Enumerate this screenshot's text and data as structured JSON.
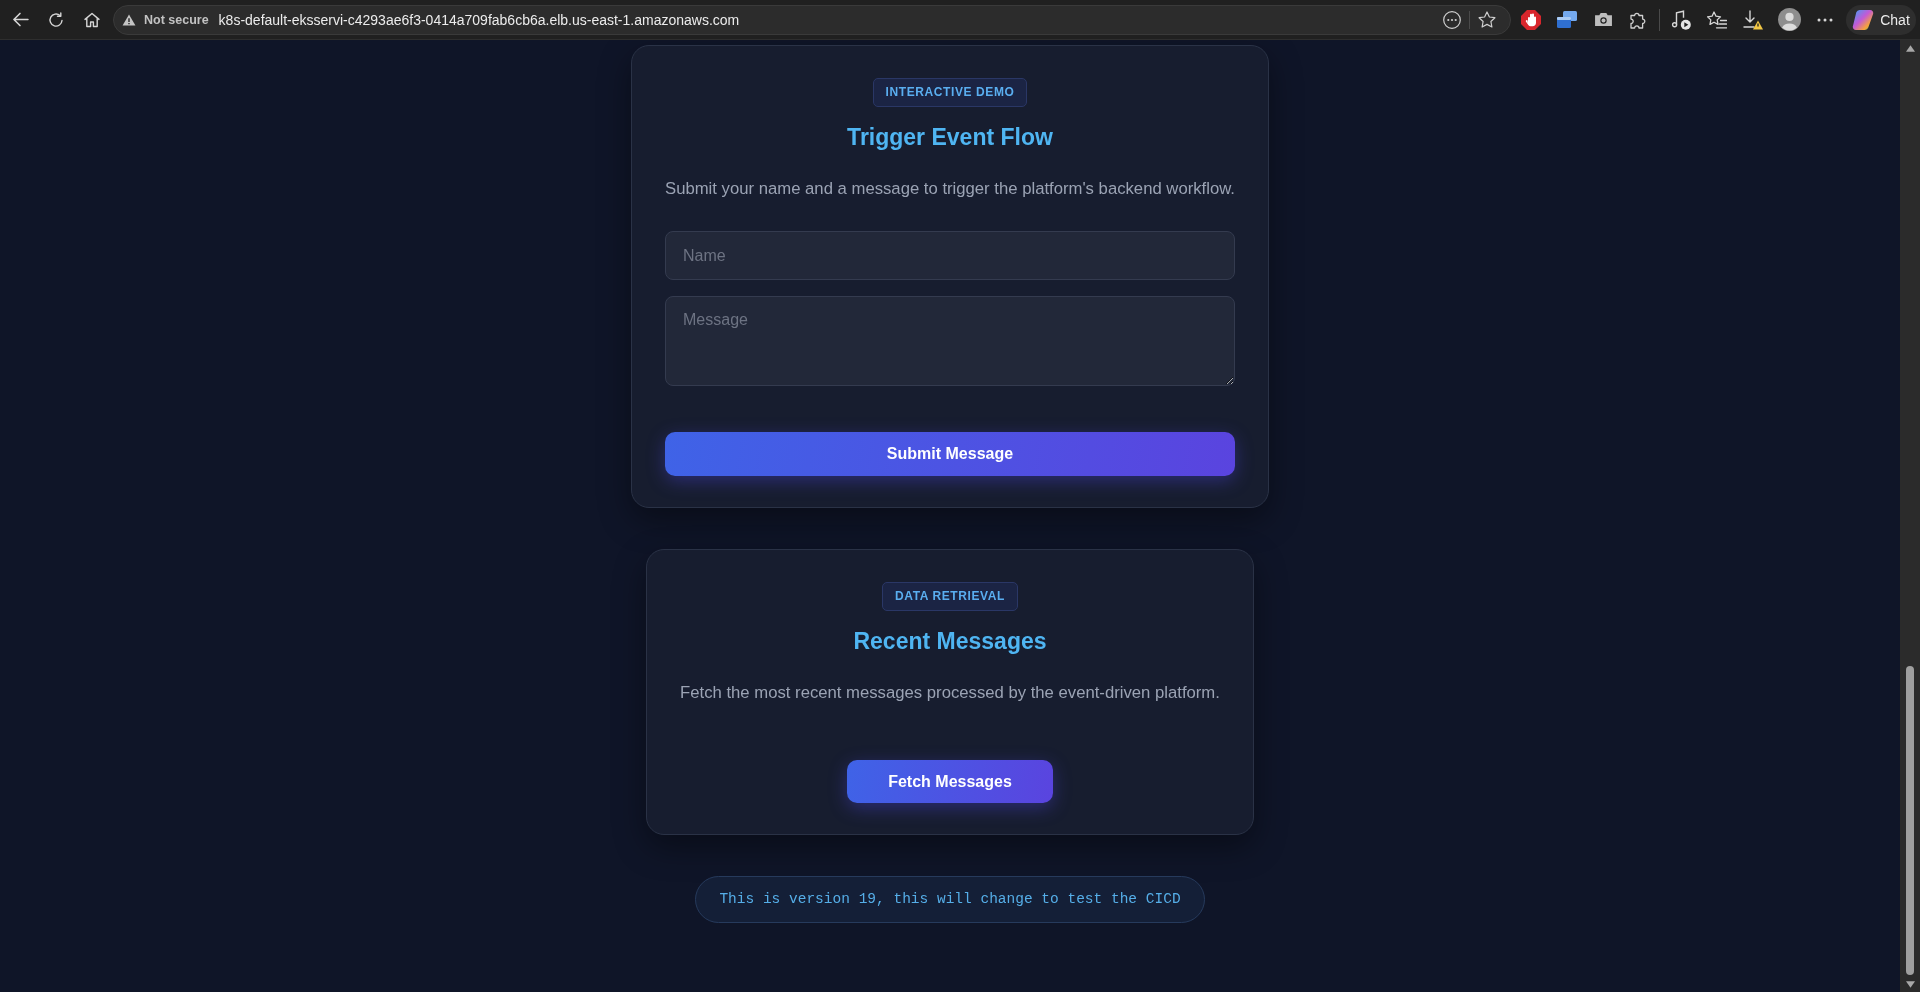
{
  "browser": {
    "security_label": "Not secure",
    "url": "k8s-default-eksservi-c4293ae6f3-0414a709fab6cb6a.elb.us-east-1.amazonaws.com",
    "chat_label": "Chat"
  },
  "cards": [
    {
      "kind": "form",
      "badge": "INTERACTIVE DEMO",
      "title": "Trigger Event Flow",
      "description": "Submit your name and a message to trigger the platform's backend workflow.",
      "fields": [
        {
          "kind": "input",
          "placeholder": "Name"
        },
        {
          "kind": "textarea",
          "placeholder": "Message"
        }
      ],
      "button": "Submit Message"
    },
    {
      "kind": "action",
      "badge": "DATA RETRIEVAL",
      "title": "Recent Messages",
      "description": "Fetch the most recent messages processed by the event-driven platform.",
      "button": "Fetch Messages"
    }
  ],
  "version_note": "This is version 19, this will change to test the CICD"
}
